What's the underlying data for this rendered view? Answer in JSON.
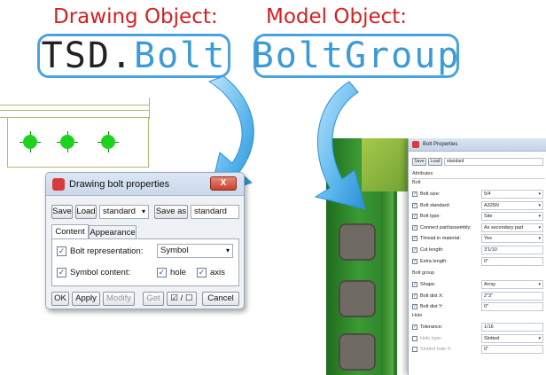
{
  "headings": {
    "drawing_object": "Drawing Object:",
    "model_object": "Model Object:"
  },
  "code": {
    "drawing_prefix": "TSD.",
    "drawing_class": "Bolt",
    "model_class": "BoltGroup"
  },
  "colors": {
    "heading": "#d42020",
    "code_border": "#4aa3df",
    "arrow": "#3da0e0",
    "bolt_symbol": "#1fd21f",
    "steel_green": "#2f8c2a"
  },
  "drawing_dialog": {
    "title": "Drawing bolt properties",
    "close_label": "X",
    "save_label": "Save",
    "load_label": "Load",
    "load_value": "standard",
    "save_as_label": "Save as",
    "save_as_value": "standard",
    "tabs": [
      "Content",
      "Appearance"
    ],
    "rows": {
      "bolt_representation_label": "Bolt representation:",
      "bolt_representation_value": "Symbol",
      "symbol_content_label": "Symbol content:",
      "hole_label": "hole",
      "axis_label": "axis"
    },
    "footer": {
      "ok": "OK",
      "apply": "Apply",
      "modify": "Modify",
      "get": "Get",
      "toggle": "☑ / ☐",
      "cancel": "Cancel"
    }
  },
  "bolt_properties": {
    "title": "Bolt Properties",
    "save_label": "Save",
    "load_label": "Load",
    "load_value": "standard",
    "sections": {
      "attributes": "Attributes",
      "bolt": "Bolt",
      "bolt_group": "Bolt group",
      "hole": "Hole"
    },
    "bolt_rows": [
      {
        "label": "Bolt size:",
        "value": "5/4",
        "dropdown": true
      },
      {
        "label": "Bolt standard:",
        "value": "A325N",
        "dropdown": true
      },
      {
        "label": "Bolt type:",
        "value": "Site",
        "dropdown": true
      },
      {
        "label": "Connect part/assembly:",
        "value": "As secondary part",
        "dropdown": true
      },
      {
        "label": "Thread in material:",
        "value": "Yes",
        "dropdown": true
      },
      {
        "label": "Cut length:",
        "value": "3'1/10",
        "dropdown": false
      },
      {
        "label": "Extra length:",
        "value": "0\"",
        "dropdown": false
      }
    ],
    "group_rows": [
      {
        "label": "Shape:",
        "value": "Array",
        "dropdown": true
      },
      {
        "label": "Bolt dist X:",
        "value": "2\"3\"",
        "dropdown": false
      },
      {
        "label": "Bolt dist Y:",
        "value": "0\"",
        "dropdown": false
      }
    ],
    "hole_rows": [
      {
        "label": "Tolerance:",
        "value": "1/16",
        "dropdown": false
      },
      {
        "label": "Hole type:",
        "value": "Slotted",
        "dropdown": true
      },
      {
        "label": "Slotted hole X:",
        "value": "0\"",
        "dropdown": false
      }
    ]
  }
}
